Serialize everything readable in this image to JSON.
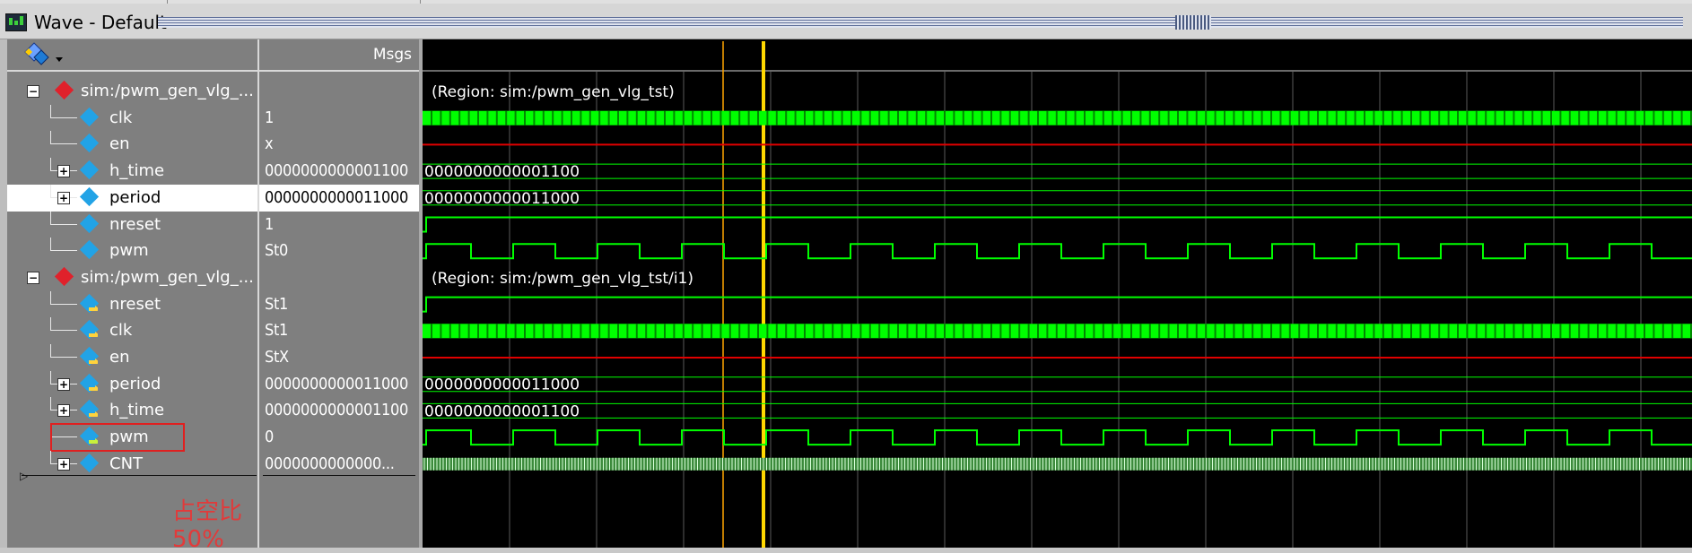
{
  "window": {
    "title": "Wave - Default"
  },
  "columns": {
    "values_header": "Msgs"
  },
  "groups": [
    {
      "region_text": "(Region: sim:/pwm_gen_vlg_tst)"
    },
    {
      "region_text": "(Region: sim:/pwm_gen_vlg_tst/i1)"
    }
  ],
  "signals": [
    {
      "name": "sim:/pwm_gen_vlg_...",
      "value": "",
      "kind": "group",
      "icon": "red-diamond-icon",
      "expander": "minus"
    },
    {
      "name": "clk",
      "value": "1",
      "kind": "clock",
      "icon": "blue-diamond-icon"
    },
    {
      "name": "en",
      "value": "x",
      "kind": "x",
      "icon": "blue-diamond-icon"
    },
    {
      "name": "h_time",
      "value": "0000000000001100",
      "wave_value": "0000000000001100",
      "kind": "bus",
      "icon": "blue-diamond-icon",
      "expander": "plus"
    },
    {
      "name": "period",
      "value": "0000000000011000",
      "wave_value": "0000000000011000",
      "kind": "bus",
      "icon": "blue-diamond-icon",
      "expander": "plus",
      "selected": true
    },
    {
      "name": "nreset",
      "value": "1",
      "kind": "reset",
      "icon": "blue-diamond-icon"
    },
    {
      "name": "pwm",
      "value": "St0",
      "kind": "pwm",
      "icon": "blue-diamond-icon"
    },
    {
      "name": "sim:/pwm_gen_vlg_...",
      "value": "",
      "kind": "group",
      "icon": "red-diamond-icon",
      "expander": "minus"
    },
    {
      "name": "nreset",
      "value": "St1",
      "kind": "reset",
      "icon": "input-port-icon"
    },
    {
      "name": "clk",
      "value": "St1",
      "kind": "clock",
      "icon": "input-port-icon"
    },
    {
      "name": "en",
      "value": "StX",
      "kind": "x",
      "icon": "input-port-icon"
    },
    {
      "name": "period",
      "value": "0000000000011000",
      "wave_value": "0000000000011000",
      "kind": "bus",
      "icon": "input-port-icon",
      "expander": "plus"
    },
    {
      "name": "h_time",
      "value": "0000000000001100",
      "wave_value": "0000000000001100",
      "kind": "bus",
      "icon": "input-port-icon",
      "expander": "plus"
    },
    {
      "name": "pwm",
      "value": "0",
      "kind": "pwm",
      "icon": "output-port-icon",
      "highlighted": true
    },
    {
      "name": "CNT",
      "value": "0000000000000...",
      "kind": "counter",
      "icon": "blue-diamond-icon",
      "expander": "plus"
    }
  ],
  "annotation": {
    "text": "占空比50%"
  },
  "cursors": [
    {
      "name": "cursor-1",
      "color": "#ffa500"
    },
    {
      "name": "cursor-2",
      "color": "#ffd800"
    }
  ],
  "colors": {
    "wave_green": "#00ff00",
    "x_red": "#e00000",
    "grid": "#5a5a5a",
    "bus": "#c8ffc8"
  }
}
